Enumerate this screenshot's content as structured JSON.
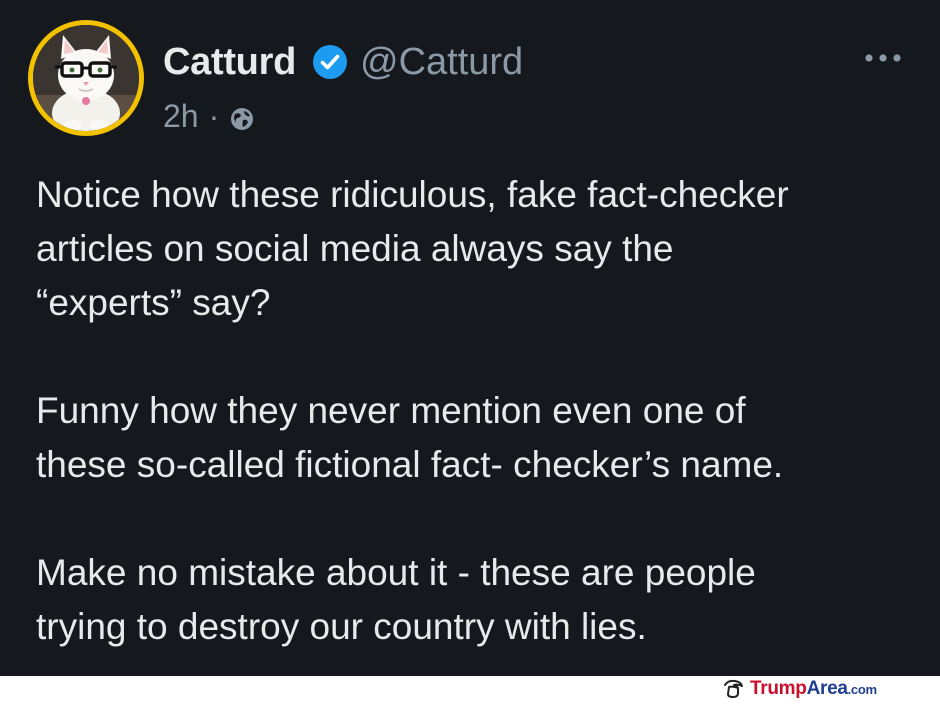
{
  "tweet": {
    "display_name": "Catturd",
    "handle": "@Catturd",
    "time": "2h",
    "separator": "·",
    "audience_icon": "globe-icon",
    "verified_icon": "verified-badge-icon",
    "more_icon": "more-options-icon",
    "paragraphs": [
      {
        "lines": [
          "Notice how these ridiculous, fake fact-checker",
          "articles on social media always say the",
          "“experts” say?"
        ]
      },
      {
        "lines": [
          "Funny how they never mention even one of",
          "these so-called fictional fact- checker’s name."
        ]
      },
      {
        "lines": [
          "Make no mistake about it - these are people",
          "trying to destroy our country with lies."
        ]
      }
    ]
  },
  "watermark": {
    "brand_part1": "Trump",
    "brand_part2": "Area",
    "suffix": ".com"
  },
  "colors": {
    "background": "#15181c",
    "text": "#e7e9ea",
    "muted": "#8b98a5",
    "verified": "#1d9bf0",
    "avatar_ring": "#f2c200",
    "watermark_red": "#c8102e",
    "watermark_blue": "#1f3f8f"
  }
}
